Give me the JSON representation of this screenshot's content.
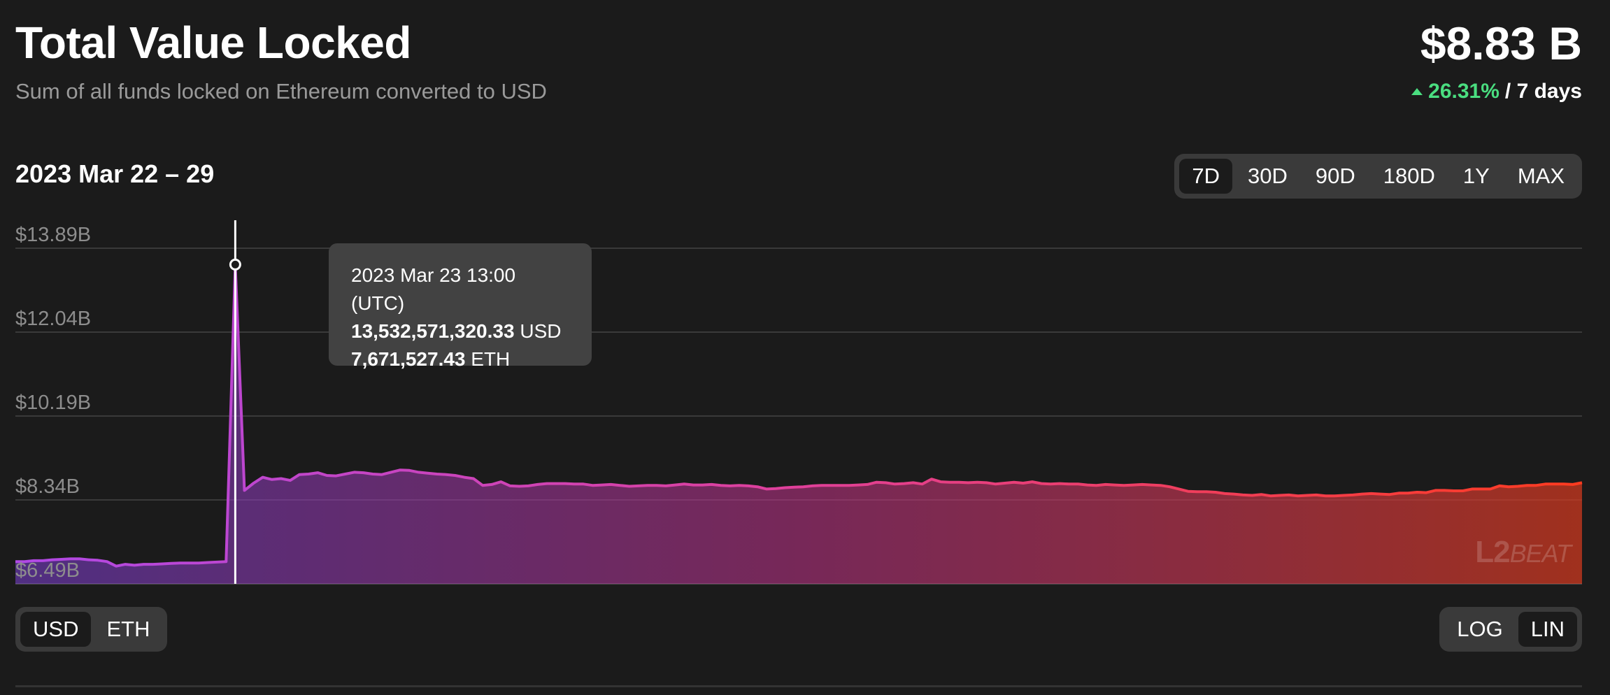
{
  "header": {
    "title": "Total Value Locked",
    "subtitle": "Sum of all funds locked on Ethereum converted to USD",
    "total_value": "$8.83 B",
    "change_pct": "26.31%",
    "change_period": "/ 7 days",
    "change_color": "#4ade80"
  },
  "date_range": "2023 Mar 22 – 29",
  "range_options": [
    "7D",
    "30D",
    "90D",
    "180D",
    "1Y",
    "MAX"
  ],
  "range_selected": "7D",
  "unit_options": [
    "USD",
    "ETH"
  ],
  "unit_selected": "USD",
  "scale_options": [
    "LOG",
    "LIN"
  ],
  "scale_selected": "LIN",
  "tooltip": {
    "date": "2023 Mar 23 13:00 (UTC)",
    "usd_value": "13,532,571,320.33",
    "usd_unit": "USD",
    "eth_value": "7,671,527.43",
    "eth_unit": "ETH"
  },
  "watermark": {
    "l2": "L2",
    "beat": "BEAT"
  },
  "chart_data": {
    "type": "area",
    "title": "Total Value Locked",
    "ylim": [
      6.49,
      13.89
    ],
    "y_ticks": [
      "$13.89B",
      "$12.04B",
      "$10.19B",
      "$8.34B",
      "$6.49B"
    ],
    "y_tick_values": [
      13.89,
      12.04,
      10.19,
      8.34,
      6.49
    ],
    "hover_index": 24,
    "gradient_colors": [
      "#7c3fd6",
      "#c2338a",
      "#d93a1e"
    ],
    "line_colors": [
      "#b049e6",
      "#e0409a",
      "#ff3b1f"
    ],
    "series": [
      {
        "values": [
          6.98,
          6.98,
          7.0,
          7.0,
          7.02,
          7.03,
          7.04,
          7.04,
          7.02,
          7.01,
          6.98,
          6.88,
          6.92,
          6.9,
          6.92,
          6.92,
          6.93,
          6.94,
          6.95,
          6.95,
          6.95,
          6.96,
          6.97,
          6.98,
          13.53,
          8.55,
          8.71,
          8.84,
          8.79,
          8.81,
          8.77,
          8.9,
          8.91,
          8.94,
          8.88,
          8.87,
          8.91,
          8.95,
          8.94,
          8.91,
          8.9,
          8.95,
          9.0,
          8.99,
          8.95,
          8.93,
          8.91,
          8.9,
          8.88,
          8.84,
          8.81,
          8.66,
          8.68,
          8.74,
          8.65,
          8.64,
          8.65,
          8.68,
          8.7,
          8.7,
          8.7,
          8.69,
          8.69,
          8.66,
          8.67,
          8.68,
          8.66,
          8.64,
          8.65,
          8.66,
          8.66,
          8.65,
          8.67,
          8.69,
          8.67,
          8.67,
          8.68,
          8.66,
          8.65,
          8.66,
          8.65,
          8.63,
          8.58,
          8.59,
          8.61,
          8.62,
          8.63,
          8.65,
          8.66,
          8.66,
          8.66,
          8.66,
          8.67,
          8.68,
          8.73,
          8.72,
          8.69,
          8.7,
          8.72,
          8.69,
          8.8,
          8.74,
          8.73,
          8.73,
          8.72,
          8.73,
          8.72,
          8.69,
          8.71,
          8.73,
          8.71,
          8.74,
          8.7,
          8.69,
          8.7,
          8.69,
          8.69,
          8.67,
          8.66,
          8.68,
          8.67,
          8.66,
          8.67,
          8.68,
          8.67,
          8.66,
          8.63,
          8.58,
          8.53,
          8.52,
          8.52,
          8.51,
          8.48,
          8.47,
          8.45,
          8.44,
          8.46,
          8.43,
          8.44,
          8.45,
          8.43,
          8.44,
          8.45,
          8.43,
          8.43,
          8.44,
          8.45,
          8.47,
          8.48,
          8.47,
          8.46,
          8.49,
          8.49,
          8.51,
          8.5,
          8.55,
          8.55,
          8.54,
          8.54,
          8.58,
          8.58,
          8.58,
          8.65,
          8.63,
          8.64,
          8.66,
          8.66,
          8.69,
          8.69,
          8.69,
          8.68,
          8.72
        ]
      }
    ]
  }
}
